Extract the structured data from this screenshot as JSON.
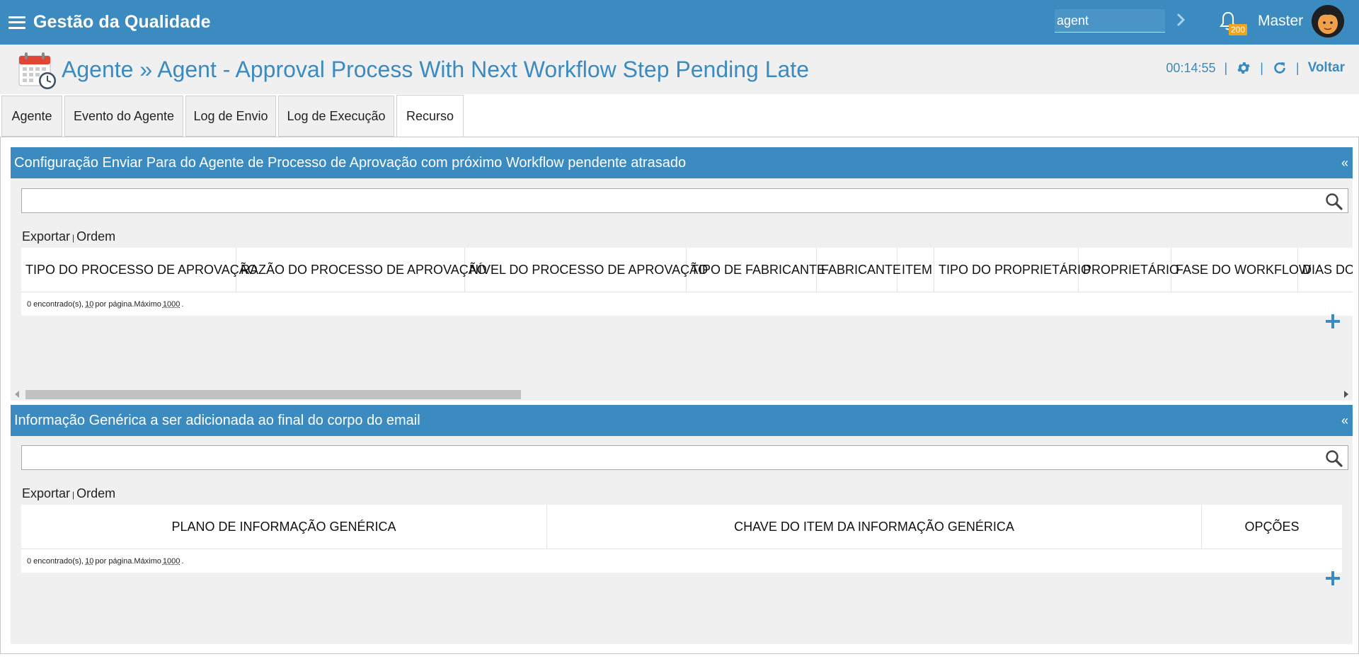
{
  "app": {
    "title": "Gestão da Qualidade"
  },
  "topbar": {
    "search_value": "agent",
    "notifications_count": "200",
    "user_name": "Master"
  },
  "header": {
    "title": "Agente » Agent - Approval Process With Next Workflow Step Pending Late",
    "timer": "00:14:55",
    "back_label": "Voltar"
  },
  "tabs": [
    {
      "label": "Agente"
    },
    {
      "label": "Evento do Agente"
    },
    {
      "label": "Log de Envio"
    },
    {
      "label": "Log de Execução"
    },
    {
      "label": "Recurso"
    }
  ],
  "panel1": {
    "title": "Configuração Enviar Para do Agente de Processo de Aprovação com próximo Workflow pendente atrasado",
    "collapse": "«",
    "export": "Exportar",
    "order": "Ordem",
    "pipe": "|",
    "columns": [
      "TIPO DO PROCESSO DE APROVAÇÃO",
      "RAZÃO DO PROCESSO DE APROVAÇÃO",
      "NÍVEL DO PROCESSO DE APROVAÇÃO",
      "TIPO DE FABRICANTE",
      "FABRICANTE",
      "ITEM",
      "TIPO DO PROPRIETÁRIO",
      "PROPRIETÁRIO",
      "FASE DO WORKFLOW",
      "DIAS DO T"
    ],
    "footer_prefix": "0 encontrado(s),",
    "footer_per_page": "10",
    "footer_mid": "por página.Máximo",
    "footer_max": "1000",
    "footer_end": "."
  },
  "panel2": {
    "title": "Informação Genérica a ser adicionada ao final do corpo do email",
    "collapse": "«",
    "export": "Exportar",
    "order": "Ordem",
    "pipe": "|",
    "columns": [
      "PLANO DE INFORMAÇÃO GENÉRICA",
      "CHAVE DO ITEM DA INFORMAÇÃO GENÉRICA",
      "OPÇÕES"
    ],
    "footer_prefix": "0 encontrado(s),",
    "footer_per_page": "10",
    "footer_mid": "por página.Máximo",
    "footer_max": "1000",
    "footer_end": "."
  },
  "colors": {
    "primary": "#3b8bc0",
    "badge": "#f1a51c",
    "panel_bg": "#f0f0f0"
  }
}
